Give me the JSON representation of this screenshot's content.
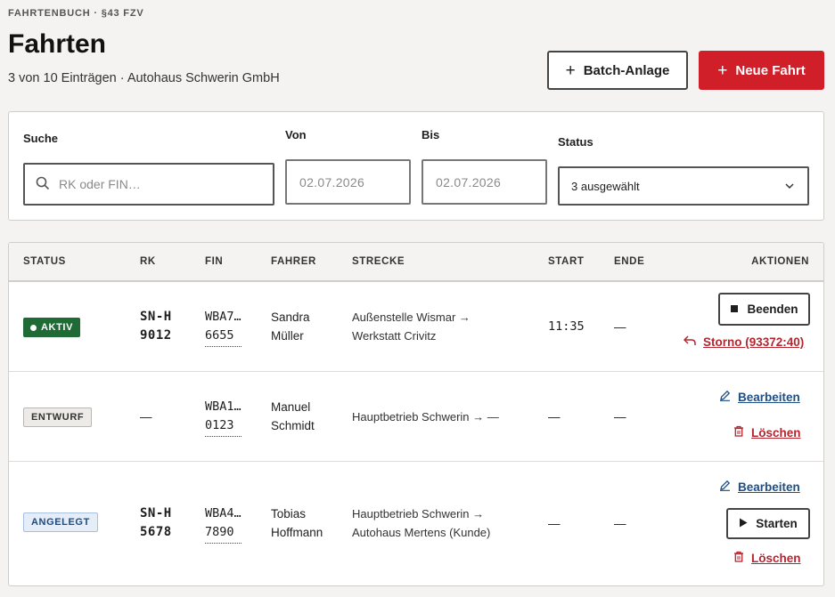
{
  "header": {
    "eyebrow": "FAHRTENBUCH · §43 FZV",
    "title": "Fahrten",
    "subtitle": "3 von 10 Einträgen · Autohaus Schwerin GmbH",
    "batch_label": "Batch-Anlage",
    "new_label": "Neue Fahrt"
  },
  "filters": {
    "search_label": "Suche",
    "search_placeholder": "RK oder FIN…",
    "from_label": "Von",
    "from_value": "02.07.2026",
    "to_label": "Bis",
    "to_value": "02.07.2026",
    "status_label": "Status",
    "status_value": "3 ausgewählt"
  },
  "table": {
    "columns": [
      "STATUS",
      "RK",
      "FIN",
      "FAHRER",
      "STRECKE",
      "START",
      "ENDE",
      "AKTIONEN"
    ],
    "rows": [
      {
        "status": "AKTIV",
        "rk_line1": "SN-H",
        "rk_line2": "9012",
        "fin_line1": "WBA7…",
        "fin_line2": "6655",
        "driver_line1": "Sandra",
        "driver_line2": "Müller",
        "route_line1": "Außenstelle Wismar →",
        "route_line2": "Werkstatt Crivitz",
        "start": "11:35",
        "end": "—",
        "actions": {
          "primary": "Beenden",
          "storno": "Storno (93372:40)"
        }
      },
      {
        "status": "ENTWURF",
        "rk": "—",
        "fin_line1": "WBA1…",
        "fin_line2": "0123",
        "driver_line1": "Manuel",
        "driver_line2": "Schmidt",
        "route_line1": "Hauptbetrieb Schwerin → —",
        "start": "—",
        "end": "—",
        "actions": {
          "edit": "Bearbeiten",
          "delete": "Löschen"
        }
      },
      {
        "status": "ANGELEGT",
        "rk_line1": "SN-H",
        "rk_line2": "5678",
        "fin_line1": "WBA4…",
        "fin_line2": "7890",
        "driver_line1": "Tobias",
        "driver_line2": "Hoffmann",
        "route_line1": "Hauptbetrieb Schwerin →",
        "route_line2": "Autohaus Mertens (Kunde)",
        "start": "—",
        "end": "—",
        "actions": {
          "edit": "Bearbeiten",
          "primary": "Starten",
          "delete": "Löschen"
        }
      }
    ]
  },
  "colors": {
    "brand_red": "#d11f2a",
    "active_green": "#1f6b35",
    "link_blue": "#1d4f86",
    "danger_red": "#b3262f"
  },
  "icons": [
    "plus-icon",
    "search-icon",
    "chevron-down-icon",
    "stop-icon",
    "undo-icon",
    "pencil-icon",
    "trash-icon",
    "play-icon"
  ]
}
